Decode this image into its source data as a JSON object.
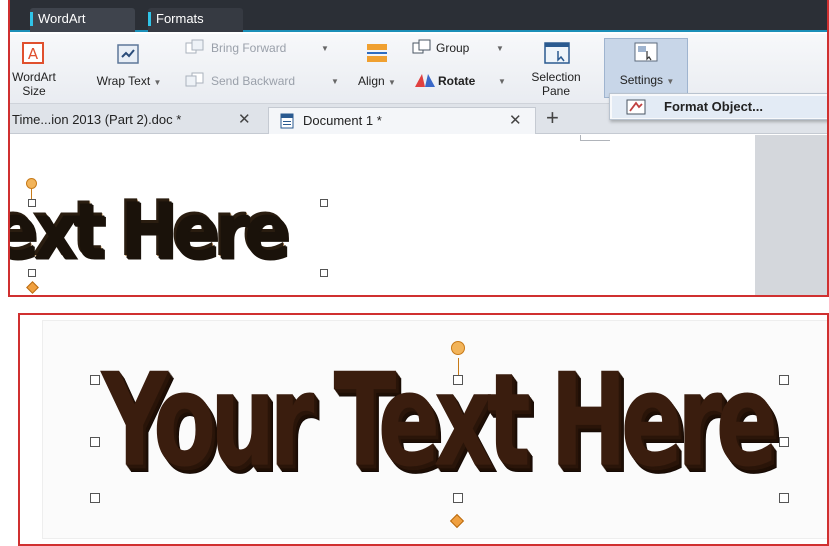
{
  "ribbon_tabs": [
    "WordArt",
    "Formats"
  ],
  "ribbon": {
    "wordart_size": {
      "line1": "WordArt",
      "line2": "Size"
    },
    "wrap_text": "Wrap Text",
    "bring_forward": "Bring Forward",
    "send_backward": "Send Backward",
    "align": "Align",
    "group": "Group",
    "rotate": "Rotate",
    "selection_pane": {
      "line1": "Selection",
      "line2": "Pane"
    },
    "settings": "Settings"
  },
  "settings_menu": {
    "format_object": "Format Object..."
  },
  "doc_tabs": {
    "tab1": "Time...ion 2013 (Part 2).doc *",
    "tab2": "Document 1 *",
    "close": "✕",
    "new_tab": "+"
  },
  "wordart": {
    "top_text": "ext Here",
    "bottom_text": "Your Text Here"
  },
  "colors": {
    "accent": "#30c4e8",
    "panel_border": "#d03030",
    "wordart_dark": "#3a1d0e",
    "wordart_texture": "#c8a27a"
  },
  "icons": {
    "wordart_size": "wordart-size-icon",
    "wrap_text": "wrap-text-icon",
    "bring_forward": "bring-forward-icon",
    "send_backward": "send-backward-icon",
    "align": "align-icon",
    "group": "group-icon",
    "rotate": "rotate-icon",
    "selection_pane": "selection-pane-icon",
    "settings": "settings-icon",
    "format_object": "format-object-icon",
    "document": "document-icon"
  }
}
